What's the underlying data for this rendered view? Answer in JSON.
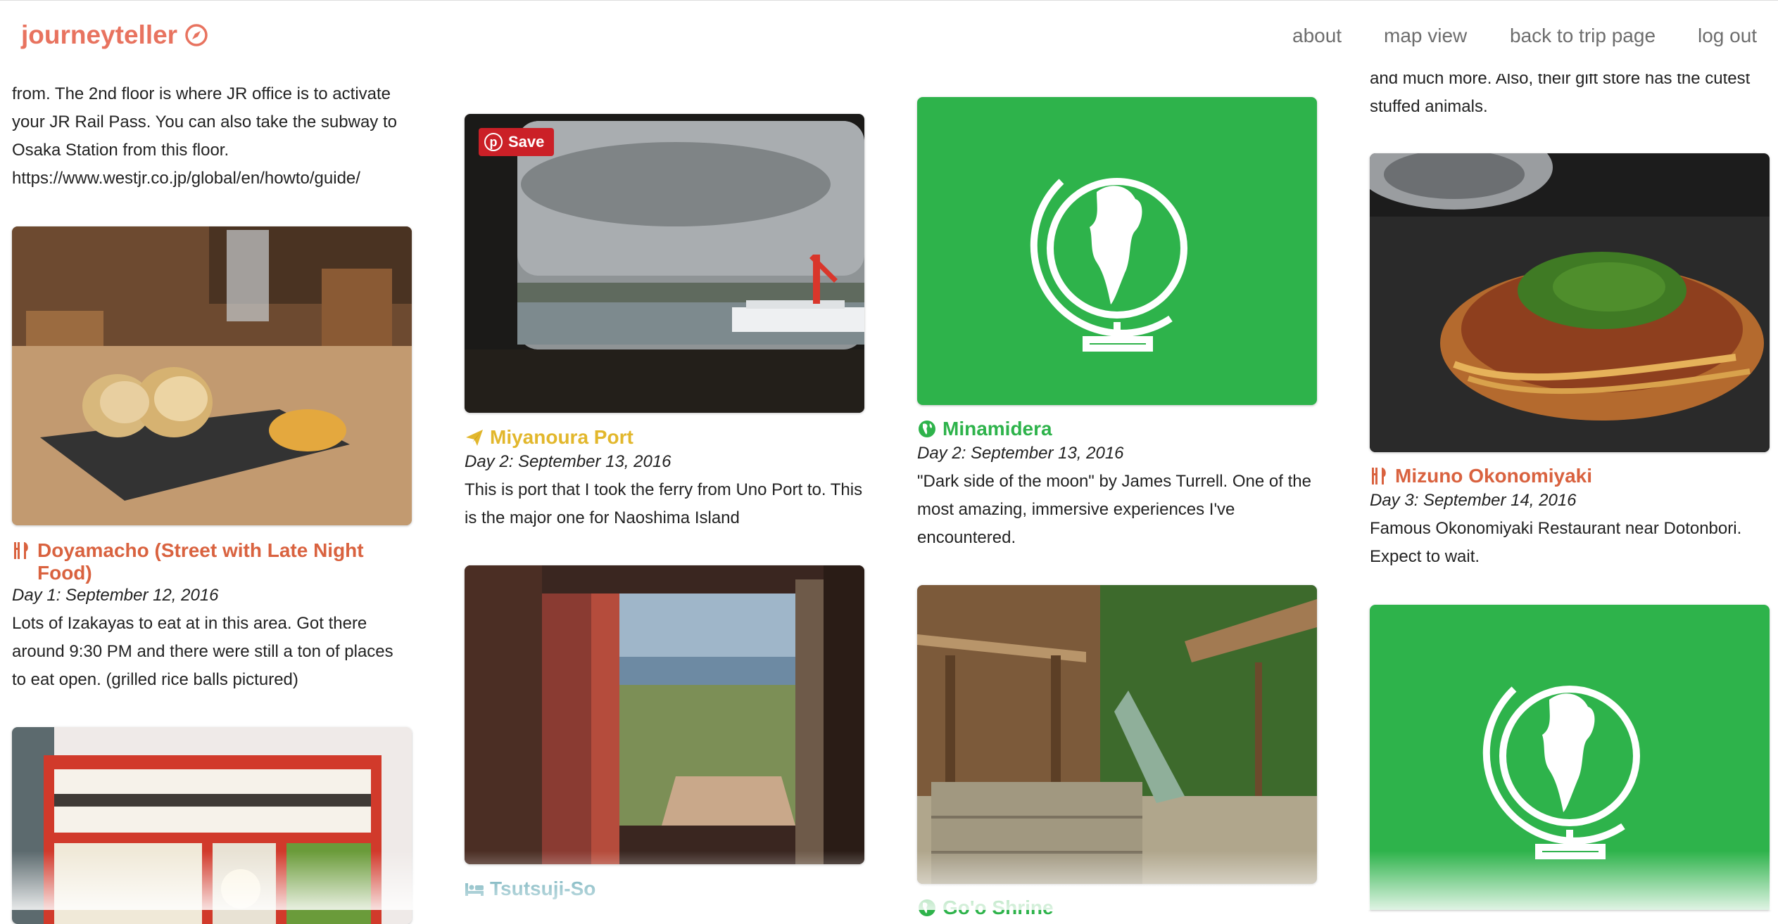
{
  "app": {
    "name": "journeyteller",
    "logo_icon": "compass-icon",
    "accent": "#e8735f"
  },
  "nav": {
    "links": [
      "about",
      "map view",
      "back to trip page",
      "log out"
    ]
  },
  "col1": {
    "top_text": [
      "from. The 2nd floor is where JR office is to activate",
      "your JR Rail Pass. You can also take the subway to",
      "Osaka Station from this floor.",
      "https://www.westjr.co.jp/global/en/howto/guide/"
    ],
    "card1": {
      "icon": "restaurant-icon",
      "title": "Doyamacho (Street with Late Night Food)",
      "date": "Day 1: September 12, 2016",
      "desc": "Lots of Izakayas to eat at in this area. Got there around 9:30 PM and there were still a ton of places to eat open. (grilled rice balls pictured)",
      "color": "#d9623f"
    }
  },
  "col2": {
    "card1": {
      "save_label": "Save",
      "icon": "paper-plane-icon",
      "title": "Miyanoura Port",
      "date": "Day 2: September 13, 2016",
      "desc": "This is port that I took the ferry from Uno Port to. This is the major one for Naoshima Island",
      "color": "#e2b72c"
    },
    "card2": {
      "icon": "bed-icon",
      "title": "Tsutsuji-So",
      "color": "#2f8a9a"
    }
  },
  "col3": {
    "card1": {
      "icon": "globe-icon",
      "title": "Minamidera",
      "date": "Day 2: September 13, 2016",
      "desc": "\"Dark side of the moon\" by James Turrell. One of the most amazing, immersive experiences I've encountered.",
      "color": "#2eb34b"
    },
    "card2": {
      "icon": "globe-icon",
      "title": "Go'o Shrine",
      "color": "#2eb34b"
    }
  },
  "col4": {
    "top_text": [
      "and much more. Also, their gift store has the cutest",
      "stuffed animals."
    ],
    "card1": {
      "icon": "restaurant-icon",
      "title": "Mizuno Okonomiyaki",
      "date": "Day 3: September 14, 2016",
      "desc": "Famous Okonomiyaki Restaurant near Dotonbori. Expect to wait.",
      "color": "#d9623f"
    }
  },
  "colors": {
    "placeholder_green": "#2eb34b",
    "pinterest_red": "#cb2027"
  }
}
